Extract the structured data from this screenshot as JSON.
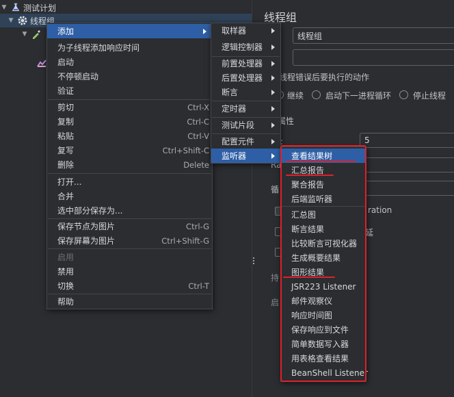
{
  "tree": {
    "items": [
      {
        "label": "测试计划"
      },
      {
        "label": "线程组"
      }
    ]
  },
  "panel": {
    "title": "线程组",
    "name_value": "线程组",
    "section_error_action": "线程错误后要执行的动作",
    "radio_continue": "继续",
    "radio_next_loop": "启动下一进程循环",
    "radio_stop_thread": "停止线程",
    "section_props": "属性",
    "threads_label": "数:",
    "threads_value": "5",
    "ramp_label": "Ra",
    "loop_label": "循",
    "same_user_label": "ration",
    "delay_label": "延",
    "dur_label": "持",
    "start_label": "启"
  },
  "menu1": {
    "items": [
      {
        "label": "添加",
        "arrow": true
      },
      {
        "label": "为子线程添加响应时间"
      },
      {
        "label": "启动"
      },
      {
        "label": "不停顿启动"
      },
      {
        "label": "验证"
      },
      {
        "label": "剪切",
        "shortcut": "Ctrl-X"
      },
      {
        "label": "复制",
        "shortcut": "Ctrl-C"
      },
      {
        "label": "粘贴",
        "shortcut": "Ctrl-V"
      },
      {
        "label": "复写",
        "shortcut": "Ctrl+Shift-C"
      },
      {
        "label": "删除",
        "shortcut": "Delete"
      },
      {
        "label": "打开..."
      },
      {
        "label": "合并"
      },
      {
        "label": "选中部分保存为..."
      },
      {
        "label": "保存节点为图片",
        "shortcut": "Ctrl-G"
      },
      {
        "label": "保存屏幕为图片",
        "shortcut": "Ctrl+Shift-G"
      },
      {
        "label": "启用"
      },
      {
        "label": "禁用"
      },
      {
        "label": "切换",
        "shortcut": "Ctrl-T"
      },
      {
        "label": "帮助"
      }
    ]
  },
  "menu2": {
    "items": [
      {
        "label": "取样器"
      },
      {
        "label": "逻辑控制器"
      },
      {
        "label": "前置处理器"
      },
      {
        "label": "后置处理器"
      },
      {
        "label": "断言"
      },
      {
        "label": "定时器"
      },
      {
        "label": "测试片段"
      },
      {
        "label": "配置元件"
      },
      {
        "label": "监听器"
      }
    ]
  },
  "menu3": {
    "items": [
      {
        "label": "查看结果树"
      },
      {
        "label": "汇总报告"
      },
      {
        "label": "聚合报告"
      },
      {
        "label": "后端监听器"
      },
      {
        "label": "汇总图"
      },
      {
        "label": "断言结果"
      },
      {
        "label": "比较断言可视化器"
      },
      {
        "label": "生成概要结果"
      },
      {
        "label": "图形结果"
      },
      {
        "label": "JSR223 Listener"
      },
      {
        "label": "邮件观察仪"
      },
      {
        "label": "响应时间图"
      },
      {
        "label": "保存响应到文件"
      },
      {
        "label": "简单数据写入器"
      },
      {
        "label": "用表格查看结果"
      },
      {
        "label": "BeanShell Listener"
      }
    ]
  },
  "colors": {
    "highlight": "#2e5fa6",
    "annotation": "#e0202a"
  }
}
